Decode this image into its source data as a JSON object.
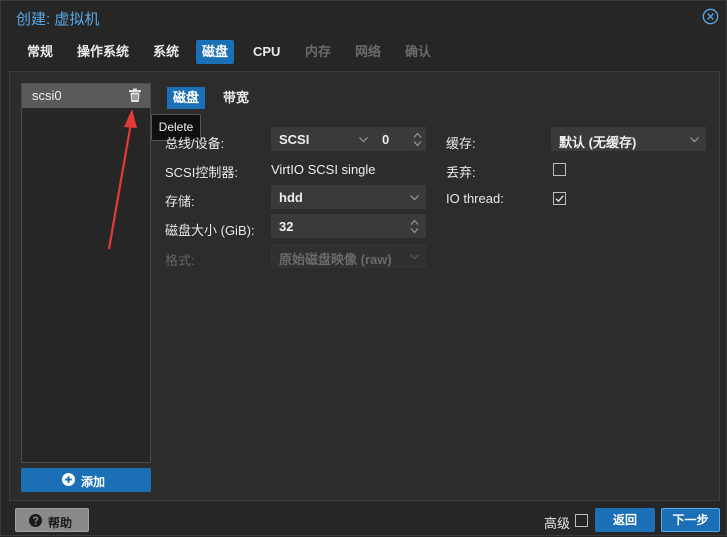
{
  "window": {
    "title": "创建: 虚拟机",
    "close_icon": "close-circle-icon"
  },
  "tabs": [
    {
      "label": "常规",
      "state": "normal"
    },
    {
      "label": "操作系统",
      "state": "normal"
    },
    {
      "label": "系统",
      "state": "normal"
    },
    {
      "label": "磁盘",
      "state": "active"
    },
    {
      "label": "CPU",
      "state": "normal"
    },
    {
      "label": "内存",
      "state": "disabled"
    },
    {
      "label": "网络",
      "state": "disabled"
    },
    {
      "label": "确认",
      "state": "disabled"
    }
  ],
  "disk_list": {
    "items": [
      {
        "label": "scsi0",
        "delete_icon": "trash-icon"
      }
    ],
    "tooltip": "Delete",
    "add_button": "添加"
  },
  "subtabs": [
    "磁盘",
    "带宽"
  ],
  "form": {
    "bus_device": {
      "label": "总线/设备:",
      "bus": "SCSI",
      "device": "0"
    },
    "scsi_controller": {
      "label": "SCSI控制器:",
      "value": "VirtIO SCSI single"
    },
    "storage": {
      "label": "存储:",
      "value": "hdd"
    },
    "disk_size": {
      "label": "磁盘大小 (GiB):",
      "value": "32"
    },
    "format": {
      "label": "格式:",
      "value": "原始磁盘映像 (raw)"
    },
    "cache": {
      "label": "缓存:",
      "value": "默认 (无缓存)"
    },
    "discard": {
      "label": "丢弃:",
      "checked": false
    },
    "io_thread": {
      "label": "IO thread:",
      "checked": true
    }
  },
  "footer": {
    "help": "帮助",
    "advanced": "高级",
    "advanced_checked": false,
    "back": "返回",
    "next": "下一步"
  },
  "colors": {
    "accent": "#1a6fb7",
    "title": "#5aa9e6",
    "annotation_arrow": "#e53935"
  }
}
